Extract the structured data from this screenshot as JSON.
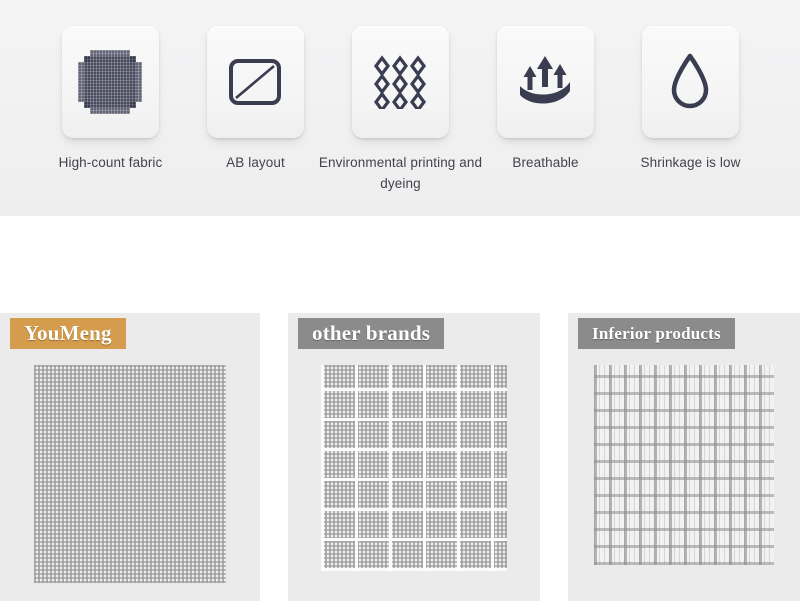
{
  "features": {
    "items": [
      {
        "icon": "fabric-swatch-icon",
        "label": "High-count fabric"
      },
      {
        "icon": "ab-layout-icon",
        "label": "AB layout"
      },
      {
        "icon": "diamond-grid-icon",
        "label": "Environmental printing and dyeing"
      },
      {
        "icon": "breathable-arrows-icon",
        "label": "Breathable"
      },
      {
        "icon": "water-droplet-icon",
        "label": "Shrinkage is low"
      }
    ]
  },
  "comparison": {
    "panels": [
      {
        "tag": "YouMeng",
        "tag_color": "#d49c4c",
        "weave": "dense",
        "weave_name": "high-count-dense-weave"
      },
      {
        "tag": "other brands",
        "tag_color": "#8b8b8b",
        "weave": "mid",
        "weave_name": "medium-gapped-weave"
      },
      {
        "tag": "Inferior products",
        "tag_color": "#8b8b8b",
        "weave": "coarse",
        "weave_name": "coarse-sparse-weave"
      }
    ]
  },
  "colors": {
    "icon_dark": "#3a3c50",
    "section_bg": "#f1f1f2",
    "panel_bg": "#ebebeb",
    "label_text": "#41444b"
  }
}
